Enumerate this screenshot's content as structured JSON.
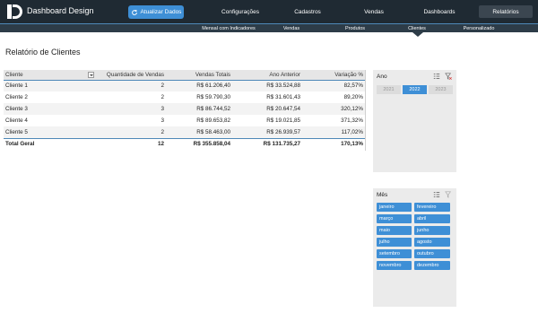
{
  "app": {
    "title": "Dashboard Design",
    "refresh_label": "Atualizar Dados"
  },
  "top_nav": [
    "Configurações",
    "Cadastros",
    "Vendas",
    "Dashboards",
    "Relatórios"
  ],
  "top_nav_active": "Relatórios",
  "sub_nav": [
    "Mensal com Indicadores",
    "Vendas",
    "Produtos",
    "Clientes",
    "Personalizado"
  ],
  "sub_nav_active": "Clientes",
  "page_title": "Relatório de Clientes",
  "table": {
    "headers": [
      "Cliente",
      "Quantidade de Vendas",
      "Vendas Totais",
      "Ano Anterior",
      "Variação %"
    ],
    "rows": [
      [
        "Cliente 1",
        "2",
        "R$ 61.206,40",
        "R$ 33.524,88",
        "82,57%"
      ],
      [
        "Cliente 2",
        "2",
        "R$ 59.790,30",
        "R$ 31.601,43",
        "89,20%"
      ],
      [
        "Cliente 3",
        "3",
        "R$ 86.744,52",
        "R$ 20.647,54",
        "320,12%"
      ],
      [
        "Cliente 4",
        "3",
        "R$ 89.653,82",
        "R$ 19.021,85",
        "371,32%"
      ],
      [
        "Cliente 5",
        "2",
        "R$ 58.463,00",
        "R$ 26.939,57",
        "117,02%"
      ]
    ],
    "total": [
      "Total Geral",
      "12",
      "R$ 355.858,04",
      "R$ 131.735,27",
      "170,13%"
    ]
  },
  "slicer_ano": {
    "title": "Ano",
    "items": [
      "2021",
      "2022",
      "2023"
    ],
    "selected": "2022"
  },
  "slicer_mes": {
    "title": "Mês",
    "items": [
      "janeiro",
      "fevereiro",
      "março",
      "abril",
      "maio",
      "junho",
      "julho",
      "agosto",
      "setembro",
      "outubro",
      "novembro",
      "dezembro"
    ]
  },
  "colors": {
    "topbar": "#1f2a33",
    "subbar": "#2d3c48",
    "accent": "#3e8fd6",
    "divider": "#4e88b8",
    "slicer_bg": "#ebebeb"
  },
  "icons": [
    "logo-icon",
    "refresh-icon",
    "multi-select-icon",
    "clear-filter-icon",
    "dropdown-filter-icon"
  ]
}
